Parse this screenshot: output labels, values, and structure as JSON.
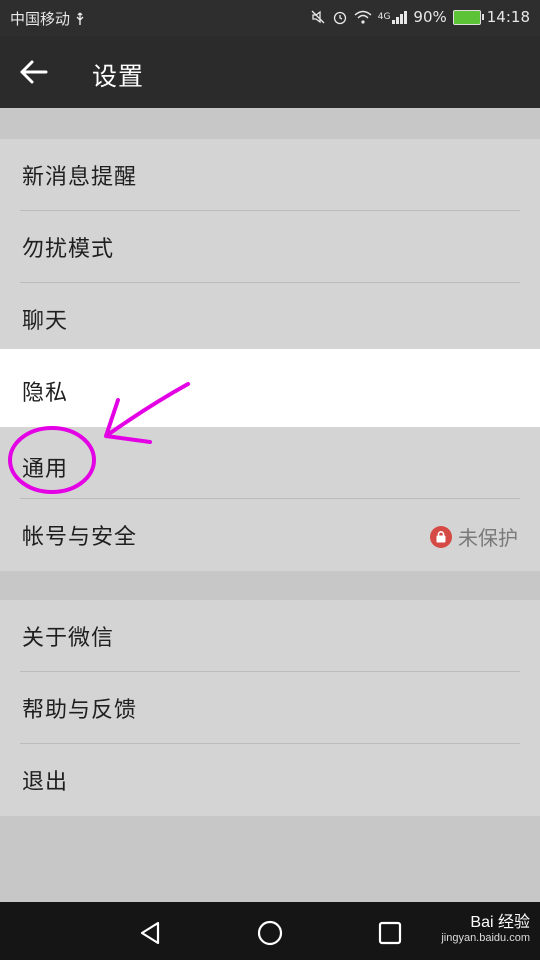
{
  "status_bar": {
    "carrier": "中国移动",
    "usb_icon": "usb-icon",
    "network_type": "4G",
    "battery_percent": "90%",
    "time": "14:18"
  },
  "title_bar": {
    "back_icon": "back-arrow-icon",
    "title": "设置"
  },
  "groups": [
    {
      "items": [
        {
          "label": "新消息提醒"
        },
        {
          "label": "勿扰模式"
        },
        {
          "label": "聊天"
        },
        {
          "label": "隐私"
        },
        {
          "label": "通用"
        },
        {
          "label": "帐号与安全",
          "status": "未保护",
          "status_icon": "lock-icon"
        }
      ]
    },
    {
      "items": [
        {
          "label": "关于微信"
        },
        {
          "label": "帮助与反馈"
        },
        {
          "label": "退出"
        }
      ]
    }
  ],
  "nav_bar": {
    "back": "triangle-back-icon",
    "home": "circle-home-icon",
    "recent": "square-recent-icon"
  },
  "watermark": {
    "text": "Bai 经验",
    "sub": "jingyan.baidu.com"
  },
  "colors": {
    "title_bg": "#2b2b2b",
    "list_bg": "#d4d4d4",
    "page_bg": "#c7c7c7",
    "annotation": "#e400e4",
    "lock_badge": "#d54a44",
    "battery": "#5cc236"
  }
}
